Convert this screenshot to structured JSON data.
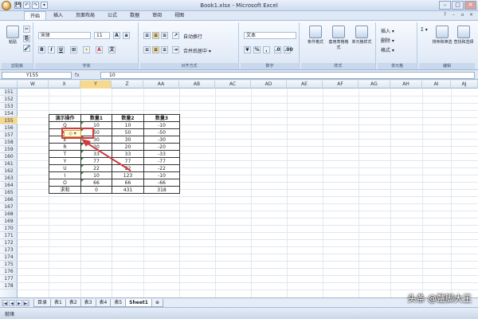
{
  "window": {
    "title": "Book1.xlsx - Microsoft Excel",
    "minimize": "–",
    "maximize": "□",
    "close": "✕"
  },
  "quick_access": [
    "💾",
    "↶",
    "↷",
    "▾"
  ],
  "tabs": [
    "开始",
    "插入",
    "页面布局",
    "公式",
    "数据",
    "审阅",
    "视图"
  ],
  "active_tab": "开始",
  "ribbon": {
    "clipboard": {
      "paste": "粘贴",
      "label": "剪贴板"
    },
    "font": {
      "name": "宋体",
      "size": "11",
      "bold": "B",
      "italic": "I",
      "underline": "U",
      "label": "字体"
    },
    "alignment": {
      "wrap": "自动换行",
      "merge": "合并后居中 ▾",
      "label": "对齐方式"
    },
    "number": {
      "format": "文本",
      "percent": "%",
      "comma": ",",
      "label": "数字"
    },
    "styles": {
      "conditional": "条件格式",
      "table": "套用表格格式",
      "cell": "单元格样式",
      "label": "样式"
    },
    "cells": {
      "insert": "插入 ▾",
      "delete": "删除 ▾",
      "format": "格式 ▾",
      "label": "单元格"
    },
    "editing": {
      "sum": "Σ ▾",
      "sort": "排序和筛选",
      "find": "查找和选择",
      "label": "编辑"
    }
  },
  "formula_bar": {
    "name_box": "Y155",
    "fx": "fx",
    "value": "10"
  },
  "columns": [
    "W",
    "X",
    "Y",
    "Z",
    "AA",
    "AB",
    "AC",
    "AD",
    "AE",
    "AF",
    "AG",
    "AH",
    "AI",
    "AJ"
  ],
  "selected_column": "Y",
  "rows": [
    "151",
    "152",
    "153",
    "154",
    "155",
    "156",
    "157",
    "158",
    "159",
    "160",
    "161",
    "162",
    "163",
    "164",
    "165",
    "166",
    "167",
    "168",
    "169",
    "170",
    "171",
    "172",
    "173",
    "174",
    "175",
    "176",
    "177",
    "178"
  ],
  "selected_row": "155",
  "table": {
    "header": [
      "演示操作",
      "数量1",
      "数量2",
      "数量3"
    ],
    "rows": [
      [
        "Q",
        "10",
        "10",
        "-10"
      ],
      [
        "W",
        "50",
        "50",
        "-50"
      ],
      [
        "E",
        "30",
        "30",
        "-30"
      ],
      [
        "R",
        "20",
        "20",
        "-20"
      ],
      [
        "T",
        "33",
        "33",
        "-33"
      ],
      [
        "Y",
        "77",
        "77",
        "-77"
      ],
      [
        "U",
        "22",
        "22",
        "-22"
      ],
      [
        "I",
        "10",
        "123",
        "-10"
      ],
      [
        "O",
        "66",
        "66",
        "-66"
      ],
      [
        "求和",
        "0",
        "431",
        "318"
      ]
    ]
  },
  "smart_tag": "◇ ▾",
  "sheets": [
    "目录",
    "表1",
    "表2",
    "表3",
    "表4",
    "表5",
    "Sheet1"
  ],
  "active_sheet": "Sheet1",
  "status": "就绪",
  "watermark": "头条 @蹩脚大王",
  "colors": {
    "accent": "#d23a3a",
    "ribbon_bg": "#dbe6f4",
    "selection": "#f7d98d"
  }
}
